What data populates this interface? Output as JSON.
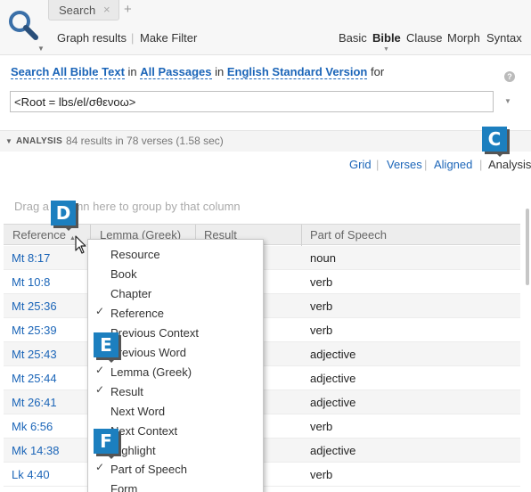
{
  "tab": {
    "label": "Search",
    "close": "×",
    "add": "+"
  },
  "toolbar": {
    "graph_results": "Graph results",
    "separator": "|",
    "make_filter": "Make Filter"
  },
  "modes": [
    "Basic",
    "Bible",
    "Clause",
    "Morph",
    "Syntax"
  ],
  "active_mode": "Bible",
  "query": {
    "search": "Search",
    "all_bible_text": "All Bible Text",
    "in1": "in",
    "all_passages": "All Passages",
    "in2": "in",
    "version": "English Standard Version",
    "for": "for",
    "value": "<Root = lbs/el/σθενοω>"
  },
  "help": "?",
  "analysis": {
    "title": "ANALYSIS",
    "count_text": "84 results in 78 verses (1.58 sec)"
  },
  "views": [
    "Grid",
    "Verses",
    "Aligned",
    "Analysis"
  ],
  "active_view": "Analysis",
  "drag_hint": "Drag a column here to group by that column",
  "columns": [
    "Reference",
    "Lemma (Greek)",
    "Result",
    "Part of Speech"
  ],
  "rows": [
    {
      "ref": "Mt 8:17",
      "pos": "noun"
    },
    {
      "ref": "Mt 10:8",
      "pos": "verb"
    },
    {
      "ref": "Mt 25:36",
      "pos": "verb"
    },
    {
      "ref": "Mt 25:39",
      "pos": "verb"
    },
    {
      "ref": "Mt 25:43",
      "pos": "adjective"
    },
    {
      "ref": "Mt 25:44",
      "pos": "adjective"
    },
    {
      "ref": "Mt 26:41",
      "pos": "adjective"
    },
    {
      "ref": "Mk 6:56",
      "pos": "verb"
    },
    {
      "ref": "Mk 14:38",
      "pos": "adjective"
    },
    {
      "ref": "Lk 4:40",
      "pos": "verb"
    }
  ],
  "menu": [
    {
      "label": "Resource",
      "checked": false
    },
    {
      "label": "Book",
      "checked": false
    },
    {
      "label": "Chapter",
      "checked": false
    },
    {
      "label": "Reference",
      "checked": true
    },
    {
      "label": "Previous Context",
      "checked": false
    },
    {
      "label": "Previous Word",
      "checked": false
    },
    {
      "label": "Lemma (Greek)",
      "checked": true
    },
    {
      "label": "Result",
      "checked": true
    },
    {
      "label": "Next Word",
      "checked": false
    },
    {
      "label": "Next Context",
      "checked": false
    },
    {
      "label": "Highlight",
      "checked": false
    },
    {
      "label": "Part of Speech",
      "checked": true
    },
    {
      "label": "Form",
      "checked": false
    }
  ],
  "check_glyph": "✓",
  "callouts": {
    "c": "C",
    "d": "D",
    "e": "E",
    "f": "F"
  }
}
